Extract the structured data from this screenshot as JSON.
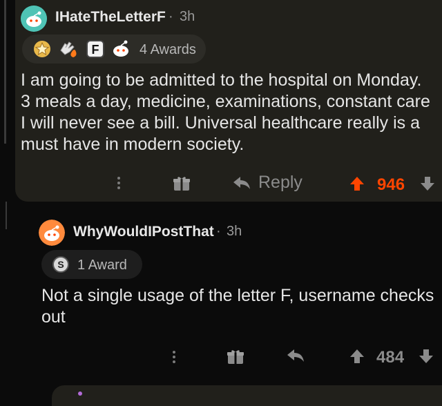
{
  "comments": [
    {
      "username": "IHateTheLetterF",
      "separator": "·",
      "time": "3h",
      "awards_label": "4 Awards",
      "award_icons": [
        "star-award-icon",
        "hand-fire-award-icon",
        "letter-f-award-icon",
        "snoo-award-icon"
      ],
      "award_letter": "F",
      "body": "I am going to be admitted to the hospital on Monday.\n3 meals a day, medicine, examinations, constant care\nI will never see a bill. Universal healthcare really is a\nmust have in modern society.",
      "reply_label": "Reply",
      "score": "946",
      "vote_color": "#ff4500"
    },
    {
      "username": "WhyWouldIPostThat",
      "separator": "·",
      "time": "3h",
      "awards_label": "1 Award",
      "award_icons": [
        "silver-award-icon"
      ],
      "award_letter": "S",
      "body": "Not a single usage of the letter F, username checks\nout",
      "score": "484",
      "vote_color": "#8b8b8b"
    }
  ],
  "colors": {
    "background": "#0b0b0b",
    "card": "#21201b",
    "upvote_active": "#ff4500",
    "muted": "#8b8b8b"
  }
}
